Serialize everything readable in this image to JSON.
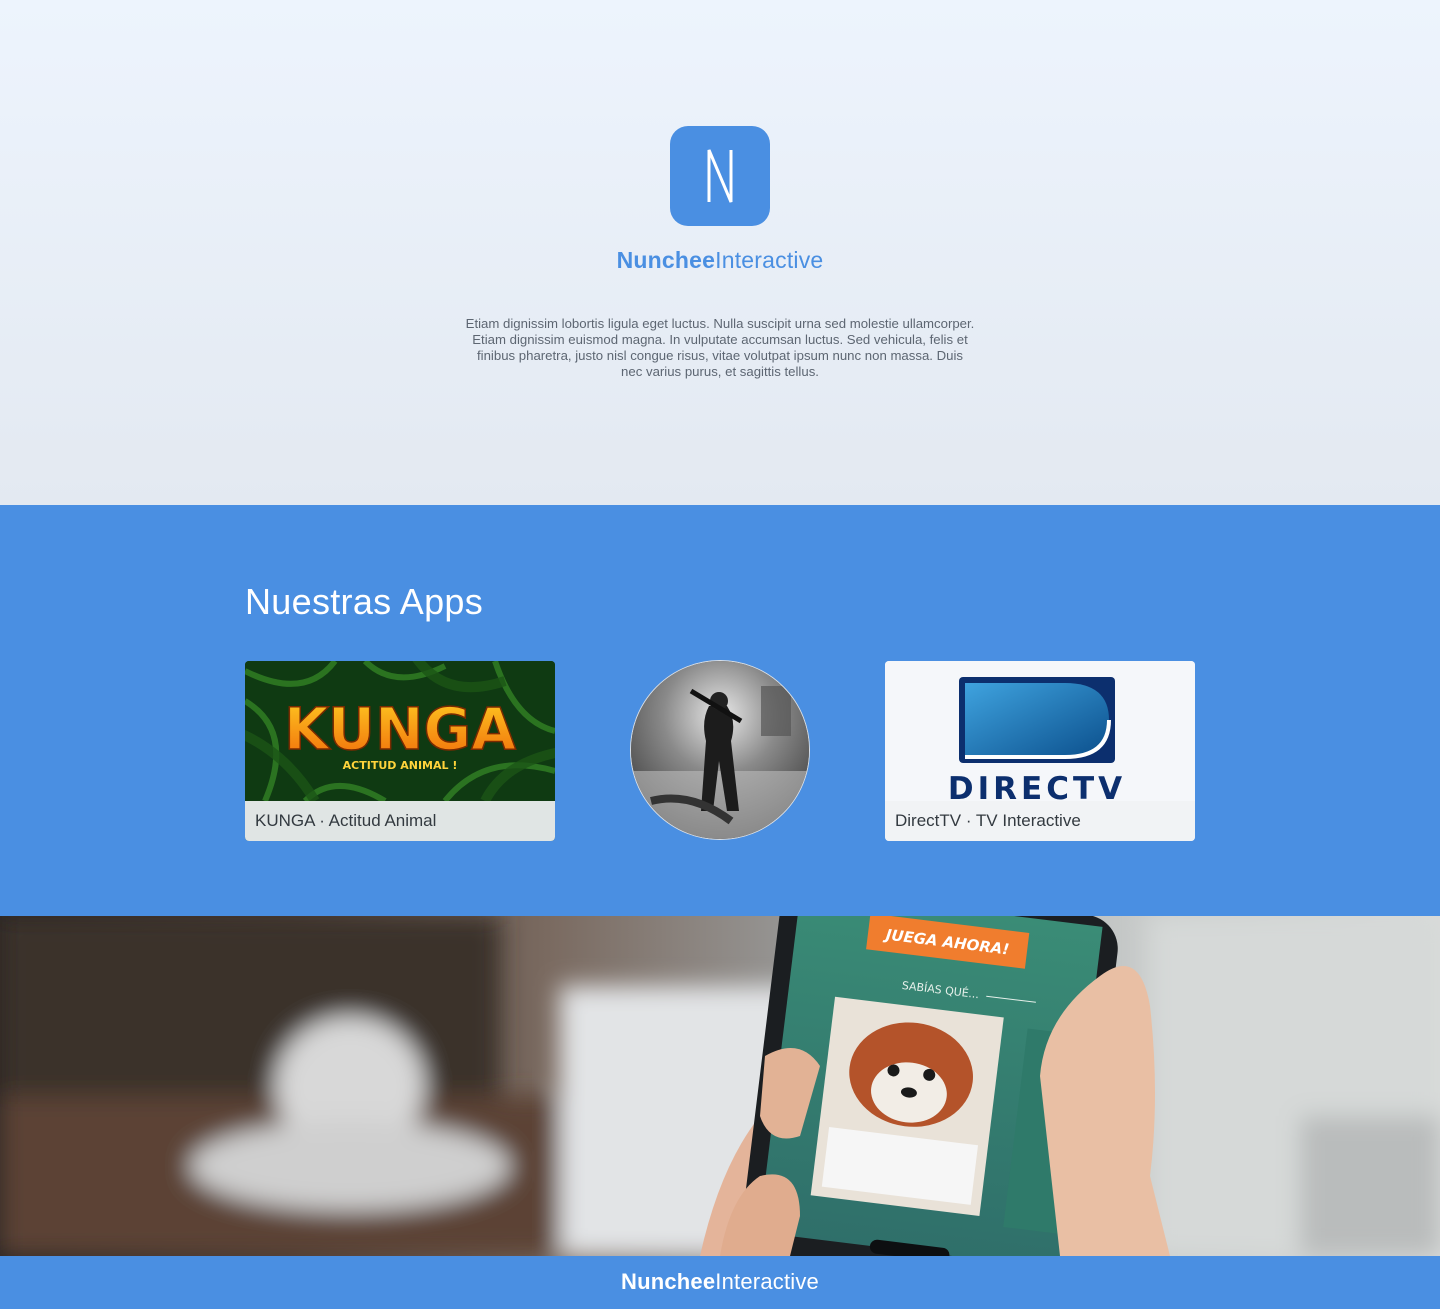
{
  "brand": {
    "name_bold": "Nunchee",
    "name_light": "Interactive",
    "logo_letter": "N"
  },
  "hero": {
    "description": "Etiam dignissim lobortis ligula eget luctus. Nulla suscipit urna sed molestie ullamcorper. Etiam dignissim euismod magna. In vulputate accumsan luctus. Sed vehicula, felis et finibus pharetra, justo nisl congue risus, vitae volutpat ipsum nunc non massa. Duis nec varius purus, et sagittis tellus."
  },
  "apps": {
    "title": "Nuestras Apps",
    "items": [
      {
        "caption": "KUNGA · Actitud Animal",
        "art_title": "KUNGA",
        "art_subtitle": "ACTITUD ANIMAL !"
      },
      {
        "caption": "",
        "image": "concert-performer-photo"
      },
      {
        "caption": "DirectTV · TV Interactive",
        "art_title": "DIRECTV"
      }
    ]
  },
  "photo": {
    "button_text": "JUEGA AHORA!",
    "section_text": "SABÍAS QUÉ...",
    "image": "hand-holding-phone-red-panda"
  },
  "footer": {
    "name_bold": "Nunchee",
    "name_light": "Interactive"
  },
  "colors": {
    "accent": "#4a8fe2",
    "hero_bg_top": "#edf4fd",
    "hero_bg_bottom": "#e3e9f1",
    "text_muted": "#5d6672"
  }
}
